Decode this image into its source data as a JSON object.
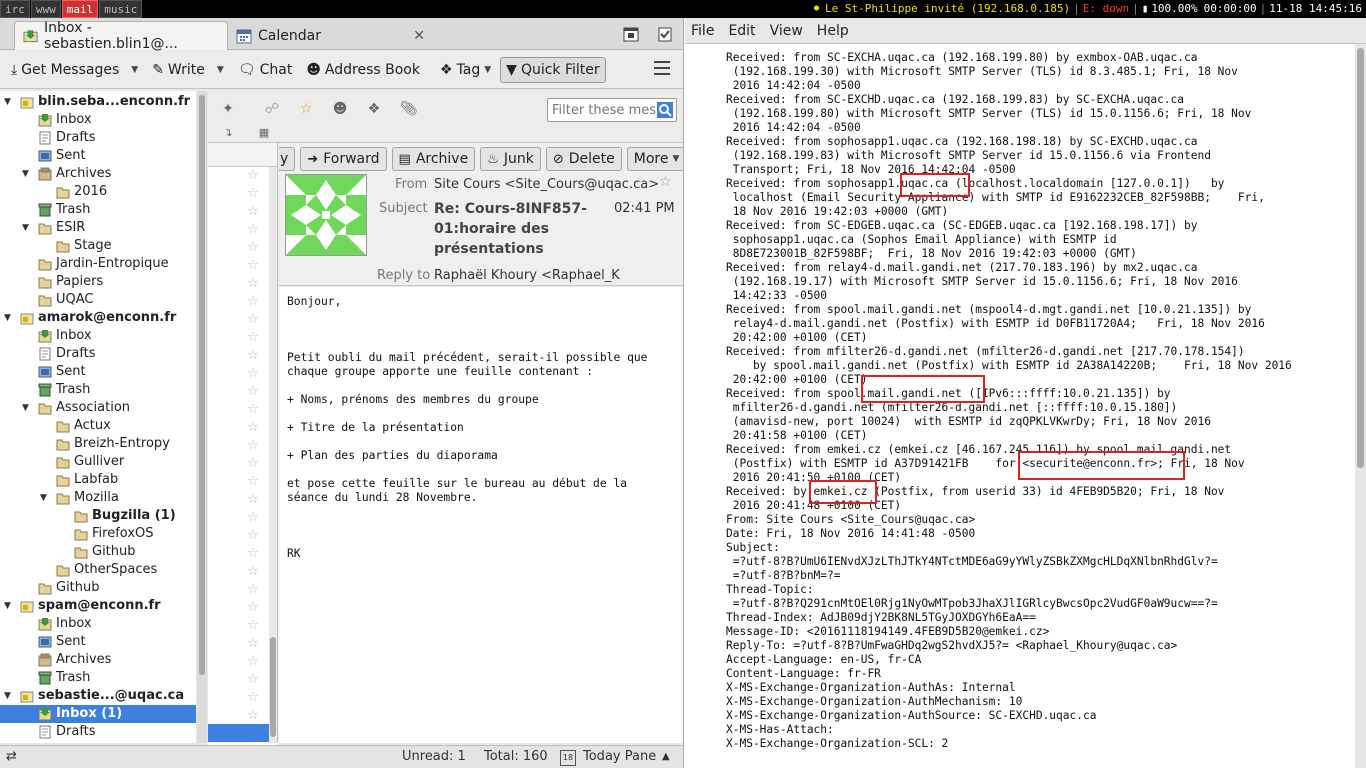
{
  "topbar": {
    "workspaces": [
      "irc",
      "www",
      "mail",
      "music"
    ],
    "active_workspace": "mail",
    "wifi": "Le St-Philippe invité (192.168.0.185)",
    "ethernet": "E: down",
    "battery": "100.00%",
    "battery_time": "00:00:00",
    "clock": "11-18 14:45:16"
  },
  "tabs": [
    {
      "label": "Inbox - sebastien.blin1@..."
    },
    {
      "label": "Calendar"
    }
  ],
  "toolbar": {
    "get_messages": "Get Messages",
    "write": "Write",
    "chat": "Chat",
    "address_book": "Address Book",
    "tag": "Tag",
    "quick_filter": "Quick Filter"
  },
  "folders": [
    {
      "label": "blin.seba...enconn.fr",
      "level": 0,
      "type": "account",
      "twisty": "open"
    },
    {
      "label": "Inbox",
      "level": 1,
      "type": "inbox"
    },
    {
      "label": "Drafts",
      "level": 1,
      "type": "drafts"
    },
    {
      "label": "Sent",
      "level": 1,
      "type": "sent"
    },
    {
      "label": "Archives",
      "level": 1,
      "type": "archives",
      "twisty": "open"
    },
    {
      "label": "2016",
      "level": 2,
      "type": "folder"
    },
    {
      "label": "Trash",
      "level": 1,
      "type": "trash"
    },
    {
      "label": "ESIR",
      "level": 1,
      "type": "folder",
      "twisty": "open"
    },
    {
      "label": "Stage",
      "level": 2,
      "type": "folder"
    },
    {
      "label": "Jardin-Entropique",
      "level": 1,
      "type": "folder"
    },
    {
      "label": "Papiers",
      "level": 1,
      "type": "folder"
    },
    {
      "label": "UQAC",
      "level": 1,
      "type": "folder"
    },
    {
      "label": "amarok@enconn.fr",
      "level": 0,
      "type": "account",
      "twisty": "open"
    },
    {
      "label": "Inbox",
      "level": 1,
      "type": "inbox"
    },
    {
      "label": "Drafts",
      "level": 1,
      "type": "drafts"
    },
    {
      "label": "Sent",
      "level": 1,
      "type": "sent"
    },
    {
      "label": "Trash",
      "level": 1,
      "type": "trash"
    },
    {
      "label": "Association",
      "level": 1,
      "type": "folder",
      "twisty": "open"
    },
    {
      "label": "Actux",
      "level": 2,
      "type": "folder"
    },
    {
      "label": "Breizh-Entropy",
      "level": 2,
      "type": "folder"
    },
    {
      "label": "Gulliver",
      "level": 2,
      "type": "folder"
    },
    {
      "label": "Labfab",
      "level": 2,
      "type": "folder"
    },
    {
      "label": "Mozilla",
      "level": 2,
      "type": "folder",
      "twisty": "open"
    },
    {
      "label": "Bugzilla (1)",
      "level": 3,
      "type": "folder",
      "bold": true
    },
    {
      "label": "FirefoxOS",
      "level": 3,
      "type": "folder"
    },
    {
      "label": "Github",
      "level": 3,
      "type": "folder"
    },
    {
      "label": "OtherSpaces",
      "level": 2,
      "type": "folder"
    },
    {
      "label": "Github",
      "level": 1,
      "type": "folder"
    },
    {
      "label": "spam@enconn.fr",
      "level": 0,
      "type": "account",
      "twisty": "open"
    },
    {
      "label": "Inbox",
      "level": 1,
      "type": "inbox"
    },
    {
      "label": "Sent",
      "level": 1,
      "type": "sent"
    },
    {
      "label": "Archives",
      "level": 1,
      "type": "archives"
    },
    {
      "label": "Trash",
      "level": 1,
      "type": "trash"
    },
    {
      "label": "sebastie...@uqac.ca",
      "level": 0,
      "type": "account",
      "twisty": "open"
    },
    {
      "label": "Inbox (1)",
      "level": 1,
      "type": "inbox",
      "bold": true,
      "selected": true
    },
    {
      "label": "Drafts",
      "level": 1,
      "type": "drafts"
    }
  ],
  "quickfilter": {
    "placeholder": "Filter these messages"
  },
  "message": {
    "buttons": {
      "reply_partial": "y",
      "forward": "Forward",
      "archive": "Archive",
      "junk": "Junk",
      "delete": "Delete",
      "more": "More"
    },
    "from_label": "From",
    "from": "Site Cours <Site_Cours@uqac.ca>",
    "subject_label": "Subject",
    "subject": "Re: Cours-8INF857-01:horaire des présentations",
    "time": "02:41 PM",
    "replyto_label": "Reply to",
    "replyto": "Raphaël Khoury <Raphael_K",
    "body": "Bonjour,\n\n\n\nPetit oubli du mail précédent, serait-il possible que\nchaque groupe apporte une feuille contenant :\n\n+ Noms, prénoms des membres du groupe\n\n+ Titre de la présentation\n\n+ Plan des parties du diaporama\n\net pose cette feuille sur le bureau au début de la\nséance du lundi 28 Novembre.\n\n\n\nRK"
  },
  "statusbar": {
    "unread": "Unread: 1",
    "total": "Total: 160",
    "today_pane": "Today Pane",
    "calendar_day": "18"
  },
  "source_viewer": {
    "menu": [
      "File",
      "Edit",
      "View",
      "Help"
    ],
    "text": "Received: from SC-EXCHA.uqac.ca (192.168.199.80) by exmbox-OAB.uqac.ca\n (192.168.199.30) with Microsoft SMTP Server (TLS) id 8.3.485.1; Fri, 18 Nov\n 2016 14:42:04 -0500\nReceived: from SC-EXCHD.uqac.ca (192.168.199.83) by SC-EXCHA.uqac.ca\n (192.168.199.80) with Microsoft SMTP Server (TLS) id 15.0.1156.6; Fri, 18 Nov\n 2016 14:42:04 -0500\nReceived: from sophosapp1.uqac.ca (192.168.198.18) by SC-EXCHD.uqac.ca\n (192.168.199.83) with Microsoft SMTP Server id 15.0.1156.6 via Frontend\n Transport; Fri, 18 Nov 2016 14:42:04 -0500\nReceived: from sophosapp1.uqac.ca (localhost.localdomain [127.0.0.1])   by\n localhost (Email Security Appliance) with SMTP id E9162232CEB_82F598BB;    Fri,\n 18 Nov 2016 19:42:03 +0000 (GMT)\nReceived: from SC-EDGEB.uqac.ca (SC-EDGEB.uqac.ca [192.168.198.17]) by\n sophosapp1.uqac.ca (Sophos Email Appliance) with ESMTP id\n 8D8E723001B_82F598BF;  Fri, 18 Nov 2016 19:42:03 +0000 (GMT)\nReceived: from relay4-d.mail.gandi.net (217.70.183.196) by mx2.uqac.ca\n (192.168.19.17) with Microsoft SMTP Server id 15.0.1156.6; Fri, 18 Nov 2016\n 14:42:33 -0500\nReceived: from spool.mail.gandi.net (mspool4-d.mgt.gandi.net [10.0.21.135]) by\n relay4-d.mail.gandi.net (Postfix) with ESMTP id D0FB11720A4;   Fri, 18 Nov 2016\n 20:42:00 +0100 (CET)\nReceived: from mfilter26-d.gandi.net (mfilter26-d.gandi.net [217.70.178.154])\n    by spool.mail.gandi.net (Postfix) with ESMTP id 2A38A14220B;    Fri, 18 Nov 2016\n 20:42:00 +0100 (CET)\nReceived: from spool.mail.gandi.net ([IPv6:::ffff:10.0.21.135]) by\n mfilter26-d.gandi.net (mfilter26-d.gandi.net [::ffff:10.0.15.180])\n (amavisd-new, port 10024)  with ESMTP id zqQPKLVKwrDy; Fri, 18 Nov 2016\n 20:41:58 +0100 (CET)\nReceived: from emkei.cz (emkei.cz [46.167.245.116]) by spool.mail.gandi.net\n (Postfix) with ESMTP id A37D91421FB    for <securite@enconn.fr>; Fri, 18 Nov\n 2016 20:41:50 +0100 (CET)\nReceived: by emkei.cz (Postfix, from userid 33) id 4FEB9D5B20; Fri, 18 Nov\n 2016 20:41:48 +0100 (CET)\nFrom: Site Cours <Site_Cours@uqac.ca>\nDate: Fri, 18 Nov 2016 14:41:48 -0500\nSubject:\n =?utf-8?B?UmU6IENvdXJzLThJTkY4NTctMDE6aG9yYWlyZSBkZXMgcHLDqXNlbnRhdGlv?=\n =?utf-8?B?bnM=?=\nThread-Topic:\n =?utf-8?B?Q291cnMtOEl0Rjg1NyOwMTpob3JhaXJlIGRlcyBwcsOpc2VudGF0aW9ucw==?=\nThread-Index: AdJB09djY2BK8NL5TGyJOXDGYh6EaA==\nMessage-ID: <20161118194149.4FEB9D5B20@emkei.cz>\nReply-To: =?utf-8?B?UmFwaGHDq2wgS2hvdXJ5?= <Raphael_Khoury@uqac.ca>\nAccept-Language: en-US, fr-CA\nContent-Language: fr-FR\nX-MS-Exchange-Organization-AuthAs: Internal\nX-MS-Exchange-Organization-AuthMechanism: 10\nX-MS-Exchange-Organization-AuthSource: SC-EXCHD.uqac.ca\nX-MS-Has-Attach:\nX-MS-Exchange-Organization-SCL: 2"
  },
  "colors": {
    "selection": "#3d80df",
    "highlight_box": "#dd2222",
    "active_workspace": "#cc3333",
    "wifi": "#e8e000",
    "eth_down": "#ff3030"
  }
}
